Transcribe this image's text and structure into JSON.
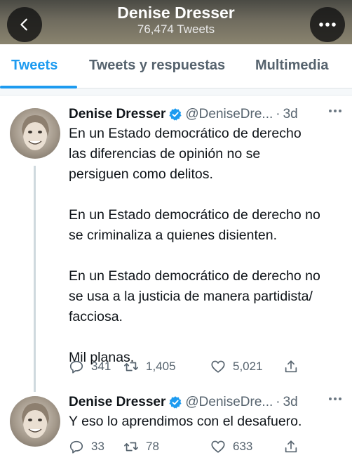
{
  "header": {
    "title": "Denise Dresser",
    "subtitle": "76,474 Tweets",
    "back_icon": "chevron-left-icon",
    "more_icon": "ellipsis-icon"
  },
  "tabs": [
    {
      "label": "Tweets",
      "active": true
    },
    {
      "label": "Tweets y respuestas",
      "active": false
    },
    {
      "label": "Multimedia",
      "active": false
    }
  ],
  "colors": {
    "accent": "#1d9bf0",
    "verified": "#1d9bf0",
    "secondary_text": "#56636e"
  },
  "tweets": [
    {
      "name": "Denise Dresser",
      "handle": "@DeniseDre...",
      "dot": "·",
      "time": "3d",
      "text": "En un Estado democrático de derecho\nlas diferencias de opinión no se\npersiguen como delitos.\n\nEn un Estado democrático de derecho no\nse criminaliza a quienes disienten.\n\nEn un Estado democrático de derecho no\nse usa a la justicia de manera partidista/\nfacciosa.\n\nMil planas.",
      "replies": "341",
      "retweets": "1,405",
      "likes": "5,021"
    },
    {
      "name": "Denise Dresser",
      "handle": "@DeniseDre...",
      "dot": "·",
      "time": "3d",
      "text": "Y eso lo aprendimos con el desafuero.",
      "replies": "33",
      "retweets": "78",
      "likes": "633"
    }
  ]
}
